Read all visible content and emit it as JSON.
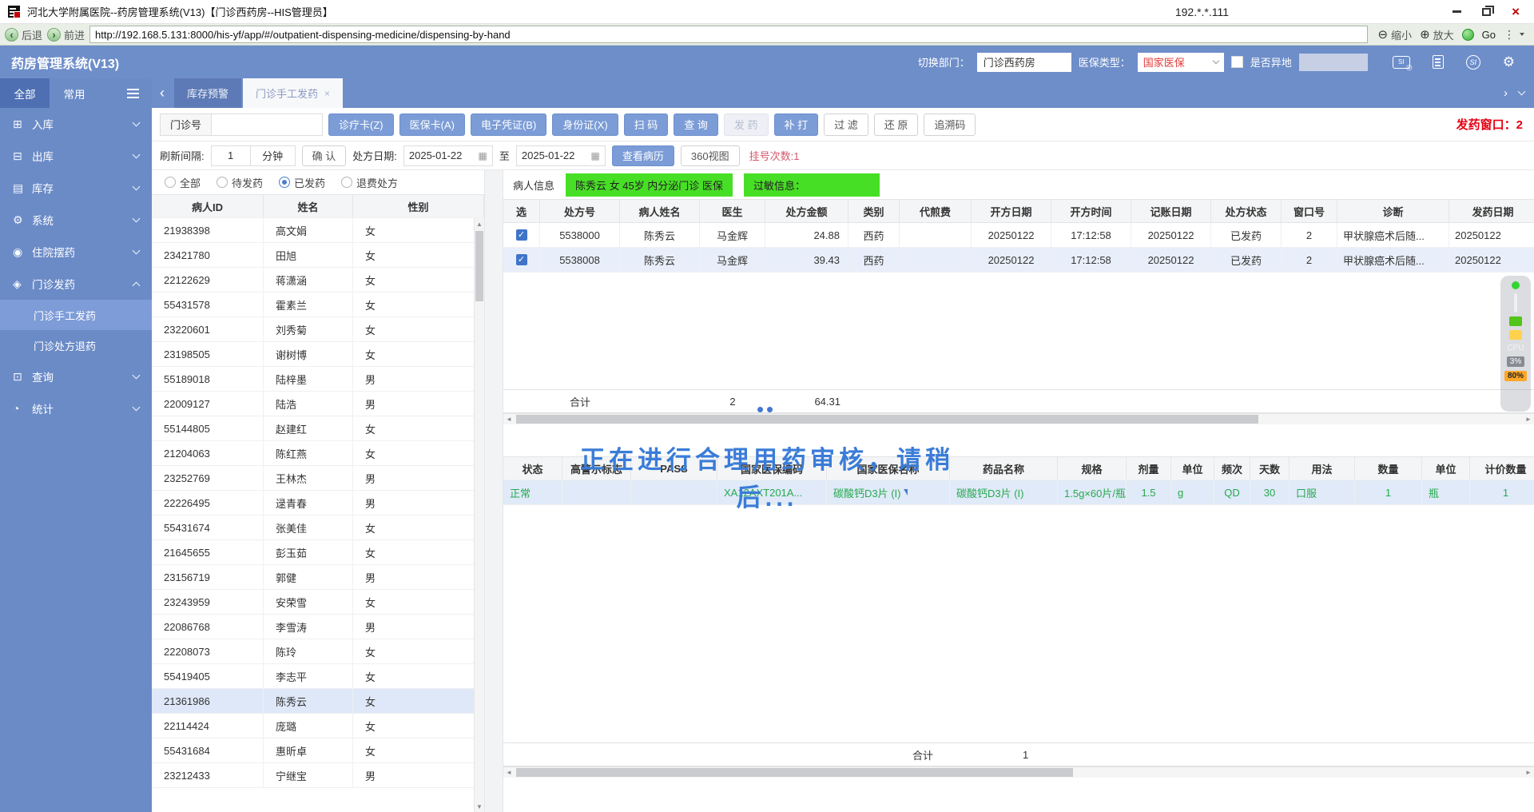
{
  "window": {
    "title": "河北大学附属医院--药房管理系统(V13)【门诊西药房--HIS管理员】",
    "ip": "192.*.*.111"
  },
  "browser": {
    "back": "后退",
    "forward": "前进",
    "url": "http://192.168.5.131:8000/his-yf/app/#/outpatient-dispensing-medicine/dispensing-by-hand",
    "zoom_out": "缩小",
    "zoom_in": "放大",
    "go": "Go"
  },
  "header": {
    "app_title": "药房管理系统(V13)",
    "dept_label": "切换部门：",
    "dept_value": "门诊西药房",
    "ins_label": "医保类型：",
    "ins_value": "国家医保",
    "remote_label": "是否异地"
  },
  "sidebar": {
    "tab_all": "全部",
    "tab_common": "常用",
    "menu": [
      {
        "icon": "⊞",
        "label": "入库"
      },
      {
        "icon": "⊟",
        "label": "出库"
      },
      {
        "icon": "▤",
        "label": "库存"
      },
      {
        "icon": "⚙",
        "label": "系统"
      },
      {
        "icon": "◉",
        "label": "住院摆药"
      },
      {
        "icon": "◈",
        "label": "门诊发药"
      },
      {
        "label": "门诊手工发药"
      },
      {
        "label": "门诊处方退药"
      },
      {
        "icon": "⊡",
        "label": "查询"
      },
      {
        "icon": "◔",
        "label": "统计"
      }
    ]
  },
  "tabs": {
    "t1": "库存预警",
    "t2": "门诊手工发药"
  },
  "toolbar": {
    "outpatient_label": "门诊号",
    "btn_card": "诊疗卡(Z)",
    "btn_ins": "医保卡(A)",
    "btn_evoucher": "电子凭证(B)",
    "btn_idcard": "身份证(X)",
    "btn_scan": "扫 码",
    "btn_query": "查 询",
    "btn_dispense": "发 药",
    "btn_reprint": "补 打",
    "btn_filter": "过 滤",
    "btn_restore": "还 原",
    "btn_trace": "追溯码",
    "window_label": "发药窗口：2"
  },
  "toolbar2": {
    "refresh_label": "刷新间隔:",
    "refresh_value": "1",
    "refresh_unit": "分钟",
    "btn_confirm": "确 认",
    "date_label": "处方日期:",
    "date_from": "2025-01-22",
    "to_label": "至",
    "date_to": "2025-01-22",
    "btn_record": "查看病历",
    "btn_360": "360视图",
    "reg_count": "挂号次数:1"
  },
  "filters": {
    "options": [
      {
        "label": "全部"
      },
      {
        "label": "待发药"
      },
      {
        "label": "已发药",
        "selected": true
      },
      {
        "label": "退费处方"
      }
    ]
  },
  "patients": {
    "columns": [
      "病人ID",
      "姓名",
      "性别"
    ],
    "rows": [
      {
        "cells": [
          "21938398",
          "高文娟",
          "女"
        ]
      },
      {
        "cells": [
          "23421780",
          "田旭",
          "女"
        ]
      },
      {
        "cells": [
          "22122629",
          "蒋潇涵",
          "女"
        ]
      },
      {
        "cells": [
          "55431578",
          "霍素兰",
          "女"
        ]
      },
      {
        "cells": [
          "23220601",
          "刘秀菊",
          "女"
        ]
      },
      {
        "cells": [
          "23198505",
          "谢树博",
          "女"
        ]
      },
      {
        "cells": [
          "55189018",
          "陆梓墨",
          "男"
        ]
      },
      {
        "cells": [
          "22009127",
          "陆浩",
          "男"
        ]
      },
      {
        "cells": [
          "55144805",
          "赵建红",
          "女"
        ]
      },
      {
        "cells": [
          "21204063",
          "陈红燕",
          "女"
        ]
      },
      {
        "cells": [
          "23252769",
          "王林杰",
          "男"
        ]
      },
      {
        "cells": [
          "22226495",
          "逯青春",
          "男"
        ]
      },
      {
        "cells": [
          "55431674",
          "张美佳",
          "女"
        ]
      },
      {
        "cells": [
          "21645655",
          "彭玉茹",
          "女"
        ]
      },
      {
        "cells": [
          "23156719",
          "郭健",
          "男"
        ]
      },
      {
        "cells": [
          "23243959",
          "安荣雪",
          "女"
        ]
      },
      {
        "cells": [
          "22086768",
          "李雪涛",
          "男"
        ]
      },
      {
        "cells": [
          "22208073",
          "陈玲",
          "女"
        ]
      },
      {
        "cells": [
          "55419405",
          "李志平",
          "女"
        ]
      },
      {
        "cells": [
          "21361986",
          "陈秀云",
          "女"
        ],
        "selected": true
      },
      {
        "cells": [
          "22114424",
          "庞璐",
          "女"
        ]
      },
      {
        "cells": [
          "55431684",
          "惠昕卓",
          "女"
        ]
      },
      {
        "cells": [
          "23212433",
          "宁继宝",
          "男"
        ]
      }
    ]
  },
  "rx": {
    "info_label": "病人信息",
    "patient_badge": "陈秀云 女 45岁 内分泌门诊 医保",
    "allergy_badge": "过敏信息：",
    "columns": [
      "选",
      "处方号",
      "病人姓名",
      "医生",
      "处方金额",
      "类别",
      "代煎费",
      "开方日期",
      "开方时间",
      "记账日期",
      "处方状态",
      "窗口号",
      "诊断",
      "发药日期"
    ],
    "rows": [
      {
        "cells": [
          "5538000",
          "陈秀云",
          "马金辉",
          "24.88",
          "西药",
          "",
          "20250122",
          "17:12:58",
          "20250122",
          "已发药",
          "2",
          "甲状腺癌术后随...",
          "20250122"
        ]
      },
      {
        "cells": [
          "5538008",
          "陈秀云",
          "马金辉",
          "39.43",
          "西药",
          "",
          "20250122",
          "17:12:58",
          "20250122",
          "已发药",
          "2",
          "甲状腺癌术后随...",
          "20250122"
        ],
        "selected": true
      }
    ],
    "total_label": "合计",
    "total_count": "2",
    "total_amount": "64.31"
  },
  "drugs": {
    "columns": [
      "状态",
      "高警示标志",
      "PASS",
      "国家医保编码",
      "国家医保名称",
      "药品名称",
      "规格",
      "剂量",
      "单位",
      "频次",
      "天数",
      "用法",
      "数量",
      "单位",
      "计价数量"
    ],
    "rows": [
      {
        "cells": [
          "正常",
          "",
          "",
          "XA12AXT201A...",
          "碳酸钙D3片 (I)",
          "碳酸钙D3片 (I)",
          "1.5g×60片/瓶",
          "1.5",
          "g",
          "QD",
          "30",
          "口服",
          "1",
          "瓶",
          "1"
        ],
        "selected": true
      }
    ],
    "total_label": "合计",
    "total_qty": "1",
    "overlay": "正在进行合理用药审核，请稍后..."
  },
  "monitor": {
    "cpu_label": "CPU",
    "cpu_value": "3%",
    "mem_value": "80%"
  }
}
